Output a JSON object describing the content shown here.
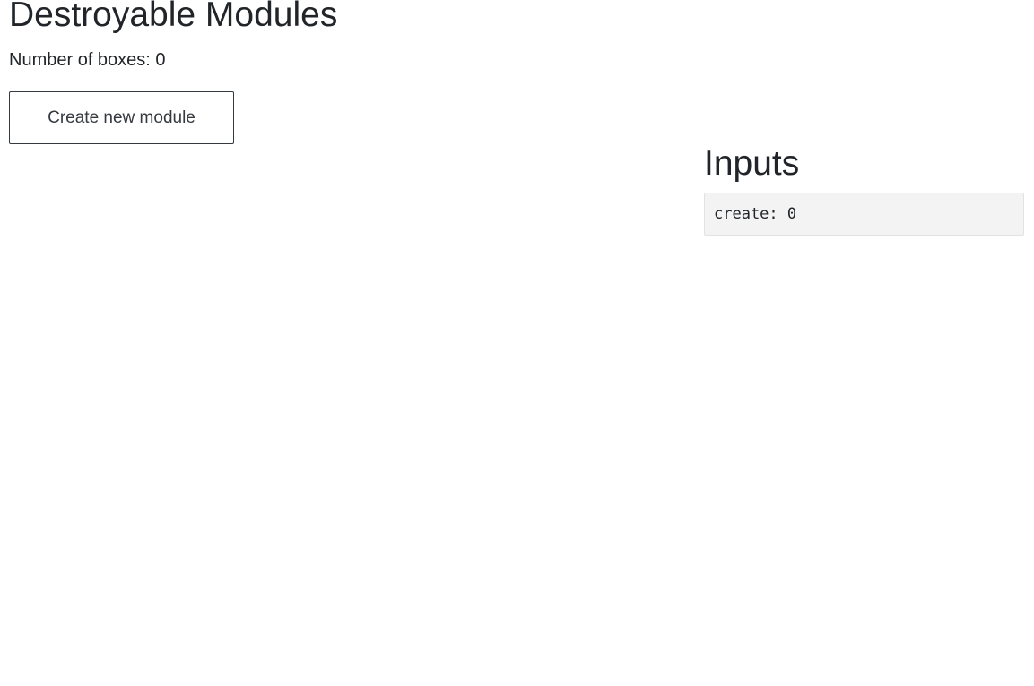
{
  "header": {
    "title": "Destroyable Modules",
    "box_count_text": "Number of boxes: 0"
  },
  "actions": {
    "create_label": "Create new module"
  },
  "inputs_panel": {
    "title": "Inputs",
    "values_text": "create: 0"
  }
}
